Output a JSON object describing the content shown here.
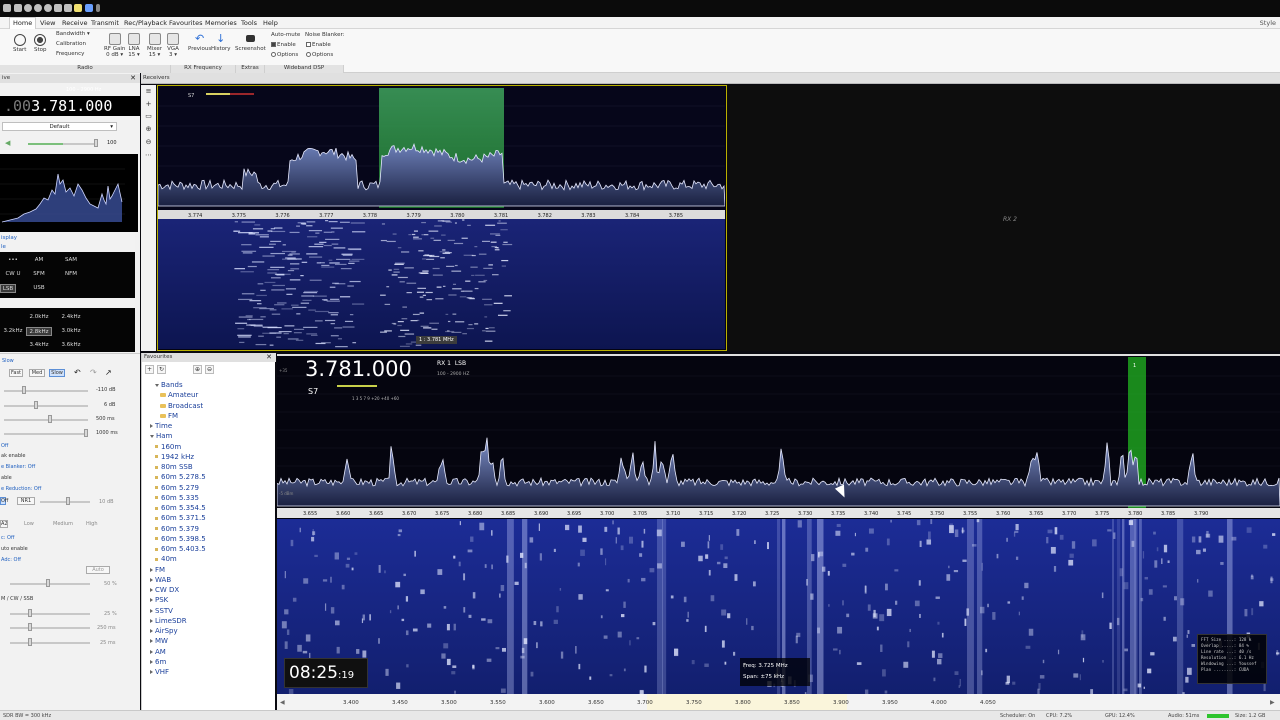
{
  "menu": {
    "items": [
      "Home",
      "View",
      "Receive",
      "Transmit",
      "Rec/Playback",
      "Favourites",
      "Memories",
      "Tools",
      "Help"
    ],
    "style_label": "Style"
  },
  "ribbon": {
    "start": "Start",
    "stop": "Stop",
    "bandwidth": "Bandwidth ▾",
    "calibration": "Calibration",
    "frequency": "Frequency",
    "rf_gain": "RF Gain",
    "rf_gain_val": "0 dB ▾",
    "lna": "LNA",
    "lna_val": "15 ▾",
    "mixer": "Mixer",
    "mixer_val": "15 ▾",
    "vga": "VGA",
    "vga_val": "3 ▾",
    "previous": "Previous",
    "history": "History",
    "screenshot": "Screenshot",
    "auto_mute": "Auto-mute",
    "noise_blanker": "Noise Blanker:",
    "enable": "Enable",
    "options": "Options",
    "groups": {
      "radio": "Radio",
      "rx_frequency": "RX Frequency",
      "extras": "Extras",
      "wideband_dsp": "Wideband DSP"
    }
  },
  "left": {
    "panel_title": "ive",
    "freq_dim": ".00",
    "freq_main": "3.781.000",
    "range": "100 - 2900 Hz",
    "preset": "Default",
    "volume": "100",
    "display_label": "isplay",
    "mode_label": "le",
    "modes": [
      "•••",
      "AM",
      "SAM",
      "CW U",
      "SFM",
      "NFM",
      "LSB",
      "USB"
    ],
    "bw": [
      "2.0kHz",
      "2.4kHz",
      "2.8kHz",
      "3.0kHz",
      "3.2kHz",
      "3.4kHz",
      "3.6kHz"
    ],
    "agc_title": "Slow",
    "agc_modes": [
      "Fast",
      "Med",
      "Slow"
    ],
    "agc_rows": [
      "-110 dB",
      "6 dB",
      "500 ms",
      "1000 ms"
    ],
    "blue_rows": [
      "Off",
      "ak enable",
      "e Blanker: Off",
      "able",
      "e Reduction: Off",
      "c: Off",
      "uto enable",
      "Adc: Off"
    ],
    "nr_buttons": [
      "Off",
      "NR1"
    ],
    "nr_level": "10 dB",
    "nr_opts": [
      "Low",
      "Medium",
      "High"
    ],
    "auto_btn": "Auto",
    "pct": "50 %",
    "bottom_rows": [
      "M / CW / SSB",
      "25 %",
      "250 ms",
      "25 ms"
    ]
  },
  "favourites": {
    "title": "Favourites",
    "tree": [
      "Bands",
      "Amateur",
      "Broadcast",
      "FM",
      "Time",
      "Ham",
      "160m",
      "1942 kHz",
      "80m SSB",
      "60m 5.278.5",
      "60m 5.279",
      "60m 5.335",
      "60m 5.354.5",
      "60m 5.371.5",
      "60m 5.379",
      "60m 5.398.5",
      "60m 5.403.5",
      "40m",
      "FM",
      "WAB",
      "CW DX",
      "PSK",
      "SSTV",
      "LimeSDR",
      "AirSpy",
      "MW",
      "AM",
      "6m",
      "VHF"
    ]
  },
  "receivers": {
    "title": "Receivers",
    "rx1_scale": [
      "3.774",
      "3.775",
      "3.776",
      "3.777",
      "3.778",
      "3.779",
      "3.780",
      "3.781",
      "3.782",
      "3.783",
      "3.784",
      "3.785"
    ],
    "rx1_marker": "1 : 3.781 MHz",
    "rx1_smeter": "S7",
    "rx2_label": "RX 2"
  },
  "main": {
    "freq": "3.781.000",
    "rx": "RX 1",
    "mode": "LSB",
    "range": "100 - 2900 HZ",
    "smeter": "S7",
    "smeter_scale": "1  3  5  7  9  +20  +40  +60",
    "scale": [
      "3.655",
      "3.660",
      "3.665",
      "3.670",
      "3.675",
      "3.680",
      "3.685",
      "3.690",
      "3.695",
      "3.700",
      "3.705",
      "3.710",
      "3.715",
      "3.720",
      "3.725",
      "3.730",
      "3.735",
      "3.740",
      "3.745",
      "3.750",
      "3.755",
      "3.760",
      "3.765",
      "3.770",
      "3.775",
      "3.780",
      "3.785",
      "3.790"
    ],
    "wide_scale": [
      "3.400",
      "3.450",
      "3.500",
      "3.550",
      "3.600",
      "3.650",
      "3.700",
      "3.750",
      "3.800",
      "3.850",
      "3.900",
      "3.950",
      "4.000",
      "4.050"
    ],
    "clock_hm": "08:25",
    "clock_s": ":19",
    "info_freq": "Freq:  3.725  MHz",
    "info_span": "Span:   ±75  kHz",
    "stats": "FFT Size ....: 128 k\nOverlap .....: 84 %\nLine rate ...: 40 /s\nResolution ..: 6.1 Hz\nWindowing ...: Youssef\nPlan ........: CUDA",
    "db_top": "+35",
    "db_label": "-5 dBm"
  },
  "status": {
    "left": "SDR  BW = 300 kHz",
    "scheduler": "Scheduler: On",
    "cpu": "CPU: 7.2%",
    "gpu": "GPU: 12.4%",
    "audio": "Audio: 51ms",
    "size": "Size: 1.2 GB"
  },
  "colors": {
    "accent": "#2b6ed6",
    "highlight": "#26c026",
    "frame": "#b9b000"
  }
}
